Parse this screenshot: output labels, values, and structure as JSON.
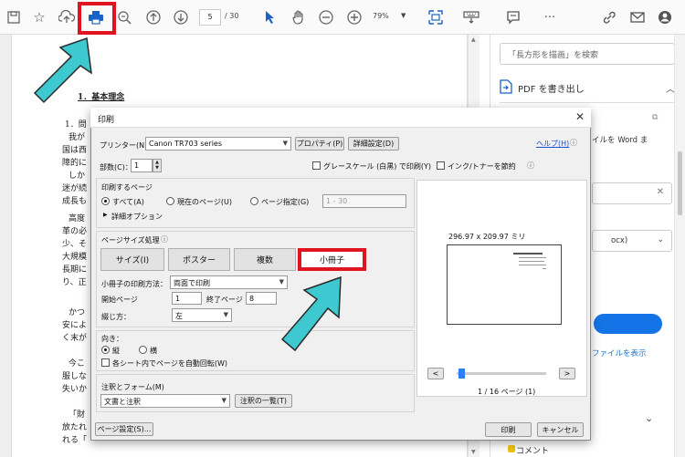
{
  "toolbar": {
    "icons": [
      "save-icon",
      "star-icon",
      "upload-icon",
      "print-icon",
      "zoom-out-search-icon",
      "page-up-icon",
      "page-down-icon",
      "pointer-icon",
      "hand-icon",
      "zoom-out-icon",
      "zoom-in-icon",
      "fit-page-icon",
      "keyboard-icon",
      "comment-icon",
      "more-icon",
      "attach-link-icon",
      "mail-icon",
      "account-icon"
    ],
    "page_current": "5",
    "page_total": "/ 30",
    "zoom": "79%",
    "more": "···"
  },
  "document": {
    "lines": [
      {
        "text": "1．基本理念",
        "bold": true
      },
      {
        "text": "1．問"
      },
      {
        "text": "我が"
      },
      {
        "text": "国は西"
      },
      {
        "text": "障的に"
      },
      {
        "text": "しか"
      },
      {
        "text": "迷が続"
      },
      {
        "text": "成長も"
      },
      {
        "text": "高度"
      },
      {
        "text": "革の必"
      },
      {
        "text": "少、そ"
      },
      {
        "text": "大規模"
      },
      {
        "text": "長期に"
      },
      {
        "text": "り、正"
      },
      {
        "text": "かつ"
      },
      {
        "text": "安によ"
      },
      {
        "text": "く末が"
      },
      {
        "text": "今こ"
      },
      {
        "text": "服しな"
      },
      {
        "text": "失いか"
      },
      {
        "text": "「財"
      },
      {
        "text": "放たれ"
      },
      {
        "text": "れる「"
      }
    ]
  },
  "right_panel": {
    "search_placeholder": "「長方形を描画」を検索",
    "export_label": "PDF を書き出し",
    "partial_word": "イルを Word ま",
    "partial_ocx": "ocx)",
    "link_text": "ファイルを表示",
    "comment_label": "コメント"
  },
  "dialog": {
    "title": "印刷",
    "printer_label": "プリンター(N)：",
    "printer_value": "Canon TR703 series",
    "properties_button": "プロパティ(P)",
    "advanced_button": "詳細設定(D)",
    "help_link": "ヘルプ(H)",
    "copies_label": "部数(C)：",
    "copies_value": "1",
    "grayscale_label": "グレースケール (白黒) で印刷(Y)",
    "save_ink_label": "インク/トナーを節約",
    "pages_group_label": "印刷するページ",
    "all_label": "すべて(A)",
    "current_page_label": "現在のページ(U)",
    "page_range_label": "ページ指定(G)",
    "page_range_value": "1 - 30",
    "more_options_label": "詳細オプション",
    "page_size_label": "ページサイズ処理",
    "tabs": [
      "サイズ(I)",
      "ポスター",
      "複数",
      "小冊子"
    ],
    "booklet_method_label": "小冊子の印刷方法：",
    "booklet_method_value": "両面で印刷",
    "start_page_label": "開始ページ",
    "start_page_value": "1",
    "end_page_label": "終了ページ",
    "end_page_value": "8",
    "binding_label": "綴じ方：",
    "binding_value": "左",
    "orientation_label": "向き：",
    "portrait_label": "縦",
    "landscape_label": "横",
    "auto_rotate_label": "各シート内でページを自動回転(W)",
    "annotations_label": "注釈とフォーム(M)",
    "annotations_value": "文書と注釈",
    "annotation_list_button": "注釈の一覧(T)",
    "page_setup_button": "ページ設定(S)...",
    "print_button": "印刷",
    "cancel_button": "キャンセル",
    "preview_size": "296.97 x 209.97 ミリ",
    "preview_page_count": "1 / 16 ページ (1)",
    "prev_button": "<",
    "next_button": ">"
  },
  "colors": {
    "highlight": "#e0141e",
    "arrow": "#3ec8cf",
    "accent": "#1473e6"
  }
}
